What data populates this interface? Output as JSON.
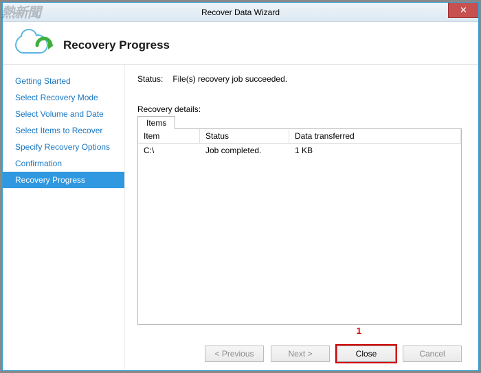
{
  "window": {
    "title": "Recover Data Wizard",
    "close_glyph": "✕"
  },
  "header": {
    "page_title": "Recovery Progress"
  },
  "sidebar": {
    "items": [
      {
        "label": "Getting Started",
        "active": false
      },
      {
        "label": "Select Recovery Mode",
        "active": false
      },
      {
        "label": "Select Volume and Date",
        "active": false
      },
      {
        "label": "Select Items to Recover",
        "active": false
      },
      {
        "label": "Specify Recovery Options",
        "active": false
      },
      {
        "label": "Confirmation",
        "active": false
      },
      {
        "label": "Recovery Progress",
        "active": true
      }
    ]
  },
  "main": {
    "status_label": "Status:",
    "status_value": "File(s) recovery job succeeded.",
    "details_label": "Recovery details:",
    "tab_label": "Items",
    "columns": {
      "item": "Item",
      "status": "Status",
      "data": "Data transferred"
    },
    "rows": [
      {
        "item": "C:\\",
        "status": "Job completed.",
        "data": "1 KB"
      }
    ]
  },
  "buttons": {
    "previous": "< Previous",
    "next": "Next >",
    "close": "Close",
    "cancel": "Cancel"
  },
  "annotation": {
    "callout": "1"
  },
  "watermark": "熱新聞"
}
